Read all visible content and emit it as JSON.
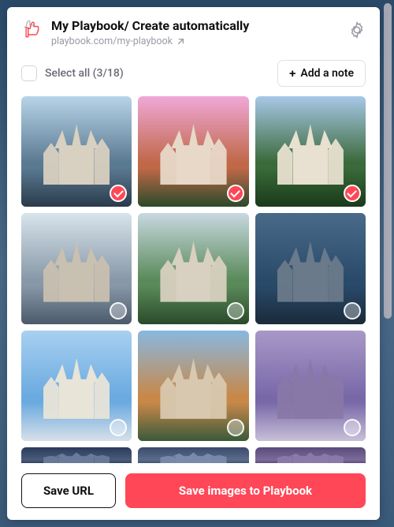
{
  "header": {
    "title": "My Playbook/ Create automatically",
    "url_display": "playbook.com/my-playbook"
  },
  "toolbar": {
    "select_all_label": "Select all (3/18)",
    "add_note_label": "Add a note"
  },
  "selection": {
    "selected_count": 3,
    "total_count": 18
  },
  "colors": {
    "accent": "#ff4757"
  },
  "thumbnails": [
    {
      "selected": true,
      "palette": {
        "sky": "#b8d4e8",
        "mid": "#5a7a92",
        "ground": "#2a3a4a",
        "bldg": "#d8d0c0"
      }
    },
    {
      "selected": true,
      "palette": {
        "sky": "#f0a8d8",
        "mid": "#c06848",
        "ground": "#2a4a2a",
        "bldg": "#e8d8c8"
      }
    },
    {
      "selected": true,
      "palette": {
        "sky": "#a8c8e8",
        "mid": "#3a6a3a",
        "ground": "#1a3a1a",
        "bldg": "#e8e0d0"
      }
    },
    {
      "selected": false,
      "palette": {
        "sky": "#d8e4ec",
        "mid": "#8898a8",
        "ground": "#4a5a6a",
        "bldg": "#c8c0b0"
      }
    },
    {
      "selected": false,
      "palette": {
        "sky": "#c8d8e0",
        "mid": "#5a8a5a",
        "ground": "#2a4a2a",
        "bldg": "#d8d0c0"
      }
    },
    {
      "selected": false,
      "palette": {
        "sky": "#4a6a8a",
        "mid": "#2a4a6a",
        "ground": "#1a2a3a",
        "bldg": "#6a7a8a"
      }
    },
    {
      "selected": false,
      "palette": {
        "sky": "#a8d0f0",
        "mid": "#6aaae0",
        "ground": "#d8e0e8",
        "bldg": "#e8e4d8"
      }
    },
    {
      "selected": false,
      "palette": {
        "sky": "#88b8e0",
        "mid": "#c88848",
        "ground": "#3a5a3a",
        "bldg": "#d8c8b0"
      }
    },
    {
      "selected": false,
      "palette": {
        "sky": "#a898c8",
        "mid": "#7868a8",
        "ground": "#c8c0d8",
        "bldg": "#8878a8"
      }
    },
    {
      "selected": false,
      "palette": {
        "sky": "#2a3a5a",
        "mid": "#4a5a7a",
        "ground": "#1a2a3a",
        "bldg": "#6a7a9a"
      }
    },
    {
      "selected": false,
      "palette": {
        "sky": "#3a4a6a",
        "mid": "#5a6a8a",
        "ground": "#2a3a4a",
        "bldg": "#7a8aaa"
      }
    },
    {
      "selected": false,
      "palette": {
        "sky": "#5a4a7a",
        "mid": "#7a6a9a",
        "ground": "#3a2a5a",
        "bldg": "#8a7aaa"
      }
    }
  ],
  "footer": {
    "save_url_label": "Save URL",
    "save_images_label": "Save images to Playbook"
  }
}
